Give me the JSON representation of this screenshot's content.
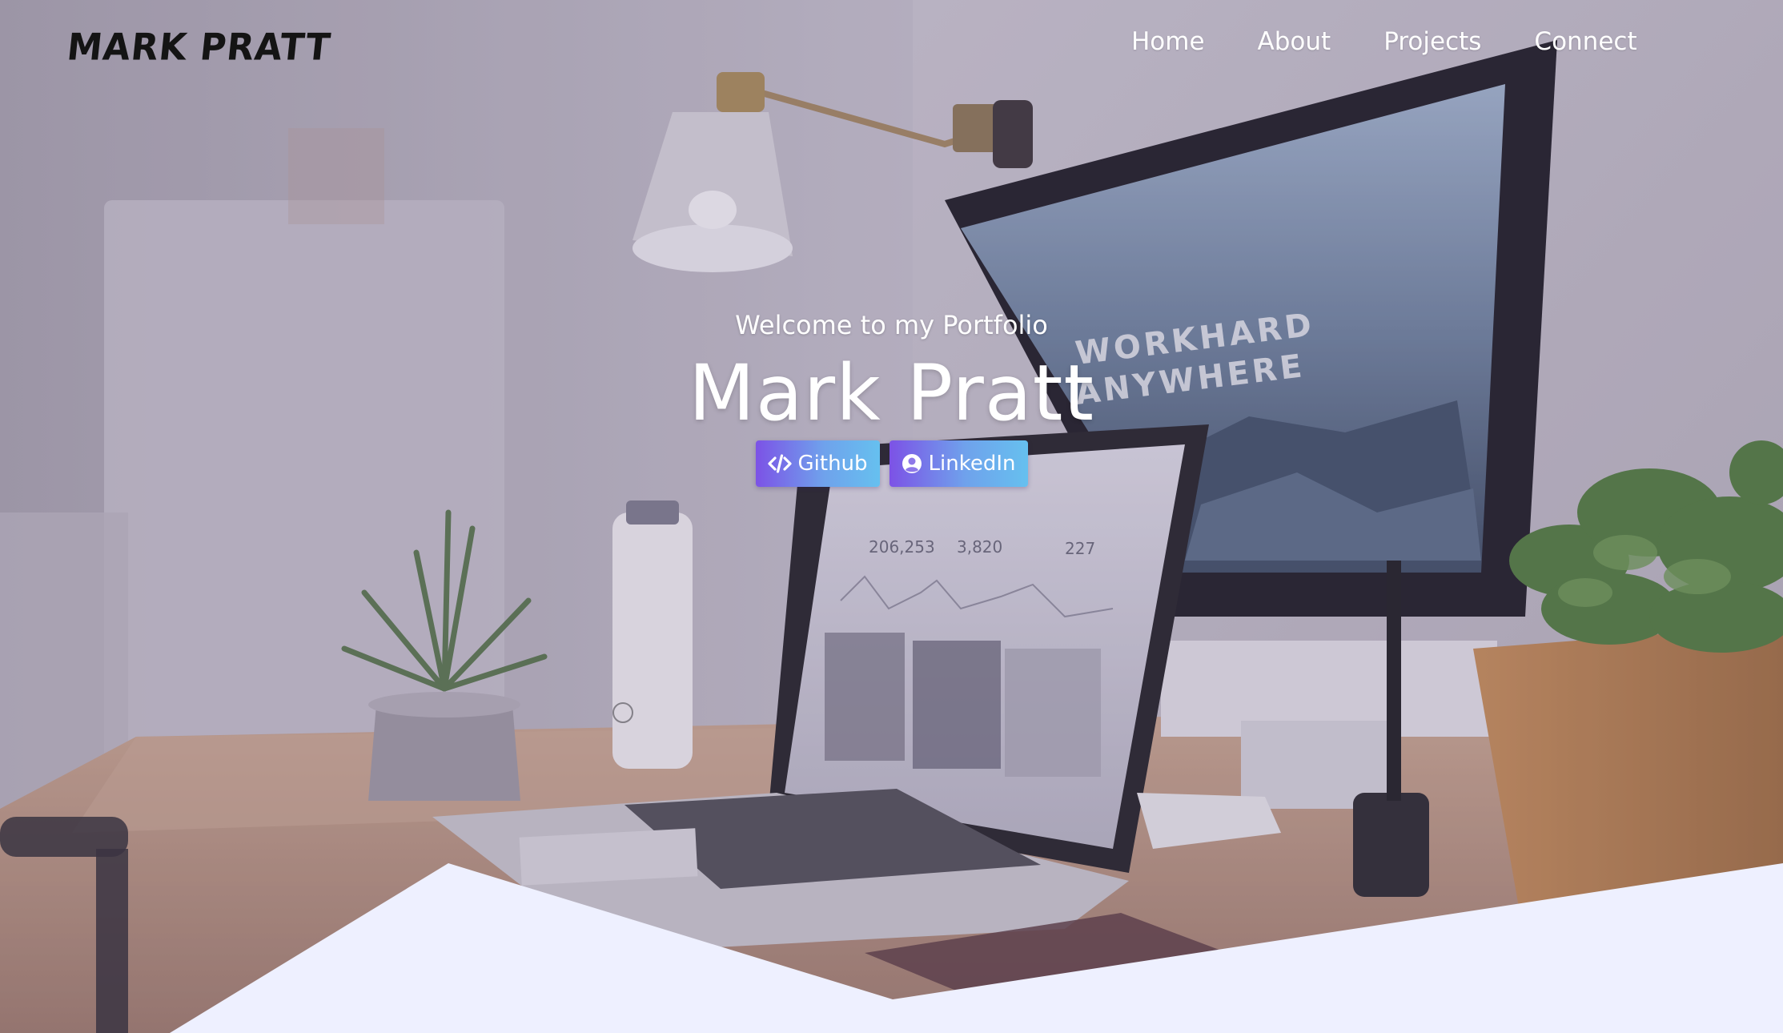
{
  "header": {
    "logo": "MARK PRATT",
    "nav": [
      {
        "label": "Home"
      },
      {
        "label": "About"
      },
      {
        "label": "Projects"
      },
      {
        "label": "Connect"
      }
    ]
  },
  "hero": {
    "subtitle": "Welcome to my Portfolio",
    "name": "Mark Pratt",
    "buttons": [
      {
        "label": "Github",
        "icon": "code-icon"
      },
      {
        "label": "LinkedIn",
        "icon": "user-circle-icon"
      }
    ]
  },
  "background": {
    "monitor_wallpaper_text": [
      "WORKHARD",
      "ANYWHERE"
    ],
    "laptop_stats": [
      "206,253",
      "3,820",
      "227"
    ]
  },
  "colors": {
    "button_gradient_start": "#7c52e6",
    "button_gradient_end": "#66c0ef",
    "wave_fill": "#eef0ff",
    "nav_text": "#ffffff",
    "logo_text": "#141414"
  }
}
